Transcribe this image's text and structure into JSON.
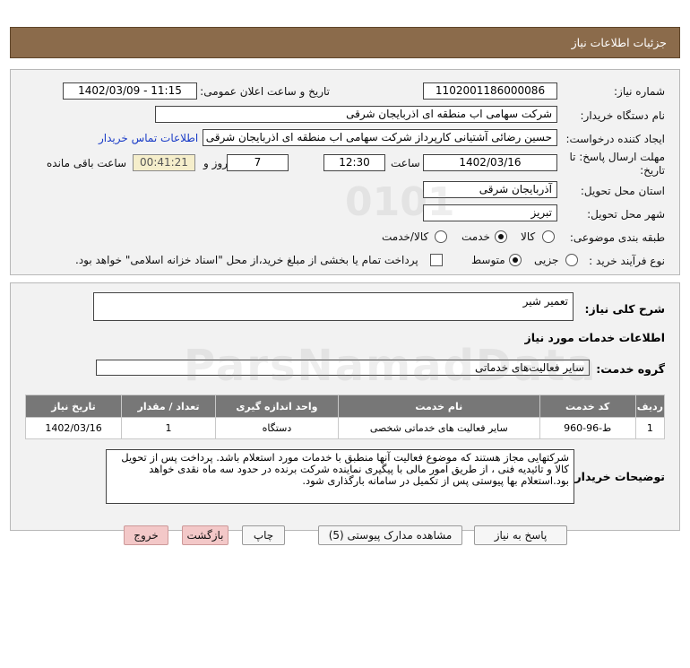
{
  "header": {
    "title": "جزئیات اطلاعات نیاز"
  },
  "form": {
    "need_number_label": "شماره نیاز:",
    "need_number": "1102001186000086",
    "announce_label": "تاریخ و ساعت اعلان عمومی:",
    "announce_value": "1402/03/09 - 11:15",
    "buyer_org_label": "نام دستگاه خریدار:",
    "buyer_org": "شرکت سهامی اب منطقه ای اذربایجان شرقی",
    "requester_label": "ایجاد کننده درخواست:",
    "requester": "حسین رضائی آشتیانی کارپرداز شرکت سهامی اب منطقه ای اذربایجان شرقی",
    "contact_link": "اطلاعات تماس خریدار",
    "deadline_label": "مهلت ارسال پاسخ: تا تاریخ:",
    "deadline_date": "1402/03/16",
    "time_label": "ساعت",
    "deadline_time": "12:30",
    "days_value": "7",
    "days_label": "روز و",
    "remaining_time": "00:41:21",
    "remaining_label": "ساعت باقی مانده",
    "province_label": "استان محل تحویل:",
    "province": "آذربایجان شرقی",
    "city_label": "شهر محل تحویل:",
    "city": "تبریز",
    "category_label": "طبقه بندی موضوعی:",
    "category_options": [
      "کالا",
      "خدمت",
      "کالا/خدمت"
    ],
    "purchase_type_label": "نوع فرآیند خرید :",
    "purchase_options": [
      "جزیی",
      "متوسط"
    ],
    "payment_note": "پرداخت تمام یا بخشی از مبلغ خرید،از محل \"اسناد خزانه اسلامی\" خواهد بود."
  },
  "details": {
    "summary_label": "شرح کلی نیاز:",
    "summary": "تعمیر شیر",
    "services_heading": "اطلاعات خدمات مورد نیاز",
    "service_group_label": "گروه خدمت:",
    "service_group": "سایر فعالیت‌های خدماتی",
    "table": {
      "headers": [
        "ردیف",
        "کد خدمت",
        "نام خدمت",
        "واحد اندازه گیری",
        "تعداد / مقدار",
        "تاریخ نیاز"
      ],
      "rows": [
        [
          "1",
          "ط-96-960",
          "سایر فعالیت های خدماتی شخصی",
          "دستگاه",
          "1",
          "1402/03/16"
        ]
      ]
    },
    "buyer_notes_label": "توضیحات خریدار:",
    "buyer_notes": "شرکتهایی مجاز هستند که موضوع فعالیت آنها منطبق با خدمات مورد استعلام باشد. پرداخت پس از تحویل کالا و تائیدیه فنی ، از طریق امور مالی با پیگیری نماینده شرکت برنده در حدود سه  ماه نقدی خواهد بود.استعلام بها پیوستی پس از تکمیل در سامانه بارگذاری شود."
  },
  "buttons": {
    "reply": "پاسخ به نیاز",
    "view_docs": "مشاهده مدارک پیوستی (5)",
    "print": "چاپ",
    "back": "بازگشت",
    "exit": "خروج"
  },
  "watermark": {
    "brand": "ParsNamadData",
    "digits": "0101"
  },
  "colors": {
    "header_bg": "#8b6b4b",
    "table_header_bg": "#777777",
    "link": "#1a3cc7",
    "remaining_bg": "#f5eecb",
    "danger_button_bg": "#f3c8c8"
  }
}
